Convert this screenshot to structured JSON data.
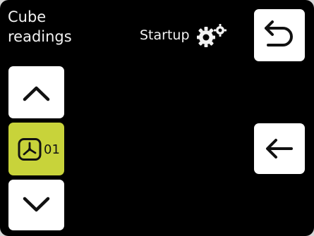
{
  "header": {
    "title_line1": "Cube",
    "title_line2": "readings",
    "status_label": "Startup",
    "status_icon": "gears-icon"
  },
  "program": {
    "number": "01",
    "icon": "fan-clock-icon"
  },
  "icons": {
    "up": "chevron-up-icon",
    "down": "chevron-down-icon",
    "back": "undo-arrow-icon",
    "left": "arrow-left-icon"
  },
  "colors": {
    "background": "#000000",
    "button": "#ffffff",
    "accent": "#c8d33a",
    "text": "#f2f2f2"
  }
}
